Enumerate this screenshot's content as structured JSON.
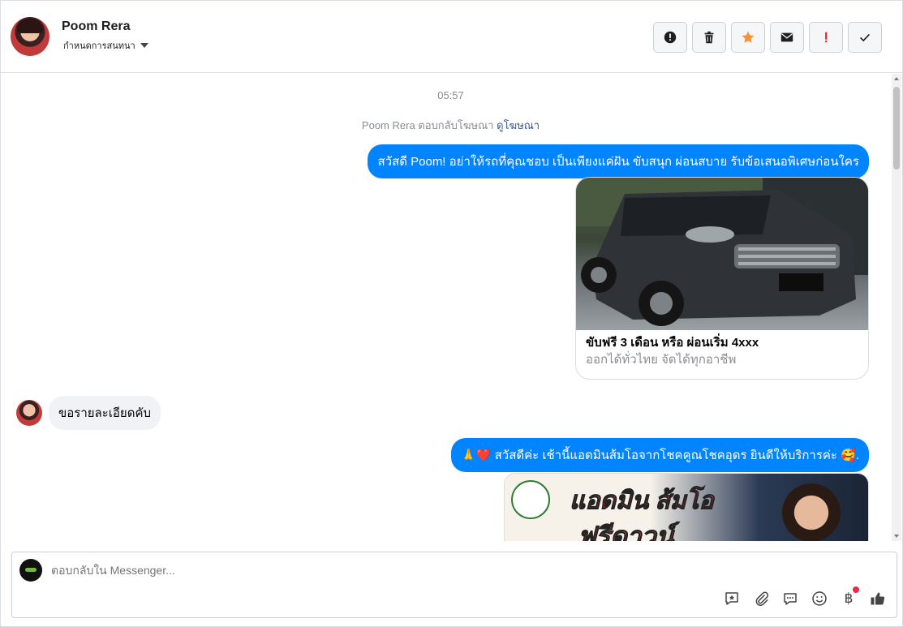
{
  "header": {
    "contact_name": "Poom Rera",
    "conversation_status": "กำหนดการสนทนา",
    "actions": [
      {
        "name": "report-spam",
        "icon": "alert-circle-icon"
      },
      {
        "name": "delete",
        "icon": "trash-icon"
      },
      {
        "name": "star",
        "icon": "star-icon",
        "color": "#f7923a"
      },
      {
        "name": "mark-unread",
        "icon": "envelope-icon"
      },
      {
        "name": "flag-follow-up",
        "icon": "exclamation-icon",
        "color": "#e4262c"
      },
      {
        "name": "mark-done",
        "icon": "checkmark-icon"
      }
    ]
  },
  "messages": {
    "timestamp": "05:57",
    "ad_reply": {
      "prefix": "Poom Rera ตอบกลับโฆษณา",
      "link": "ดูโฆษณา"
    },
    "outgoing_1": "สวัสดี Poom! อย่าให้รถที่คุณชอบ เป็นเพียงแค่ฝัน ขับสนุก ผ่อนสบาย รับข้อเสนอพิเศษก่อนใคร",
    "ad_card": {
      "title": "ขับฟรี 3 เดือน หรือ ผ่อนเริ่ม 4xxx",
      "subtitle": "ออกได้ทั่วไทย จัดได้ทุกอาชีพ"
    },
    "incoming_1": "ขอรายละเอียดคับ",
    "outgoing_2": "🙏❤️ สวัสดีค่ะ เช้านี้แอดมินส้มโอจากโชคคูณโชคอุดร ยินดีให้บริการค่ะ 🥰.",
    "promo_banner": {
      "line1": "แอดมิน",
      "line1b": "ส้มโอ",
      "line2": "ฟรีดาวน์"
    }
  },
  "composer": {
    "placeholder": "ตอบกลับใน Messenger...",
    "currency_symbol": "฿",
    "tools": [
      "saved-reply-icon",
      "attachment-icon",
      "chat-bubble-icon",
      "emoji-icon",
      "payment-icon",
      "like-icon"
    ]
  },
  "colors": {
    "accent": "#0084ff",
    "incoming_bubble": "#f0f2f5",
    "link": "#385898",
    "notification_dot": "#f02849"
  }
}
